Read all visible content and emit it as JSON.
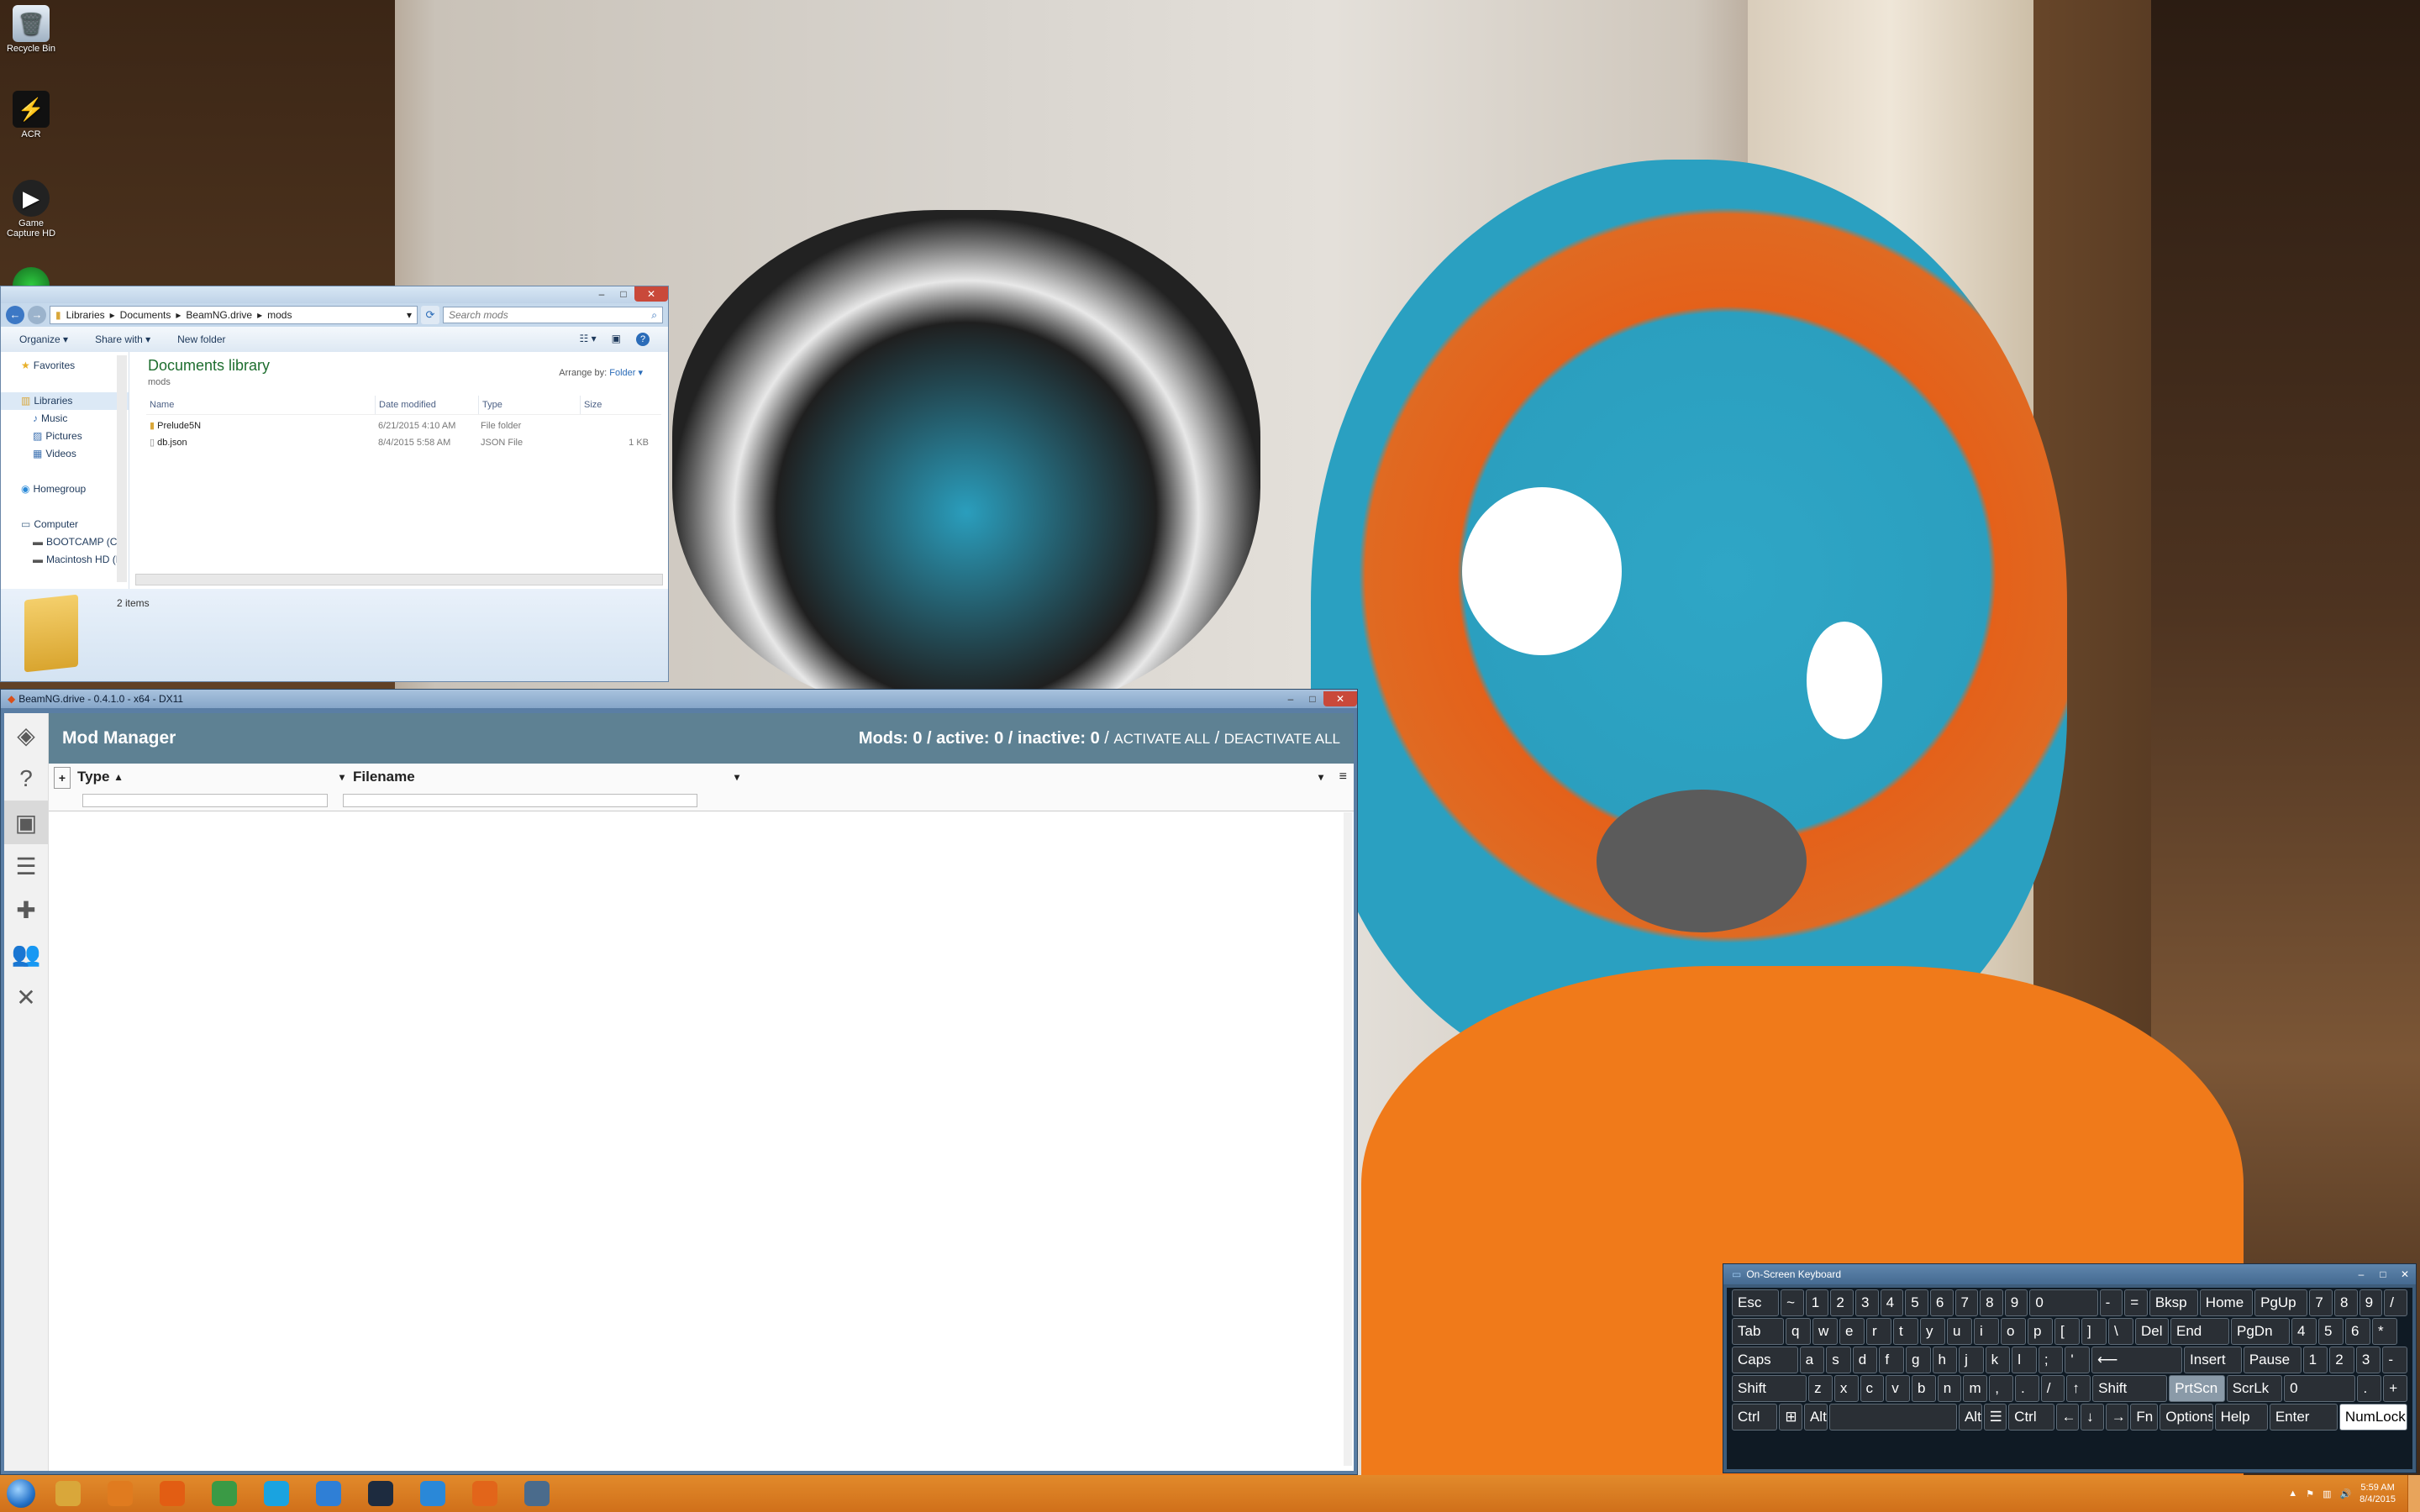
{
  "desktop": {
    "icons": [
      {
        "label": "Recycle Bin",
        "icon": "recycle-bin-icon"
      },
      {
        "label": "ACR",
        "icon": "acr-icon"
      },
      {
        "label": "Game Capture HD",
        "icon": "game-capture-icon"
      }
    ]
  },
  "explorer": {
    "breadcrumb": [
      "Libraries",
      "Documents",
      "BeamNG.drive",
      "mods"
    ],
    "search_placeholder": "Search mods",
    "commands": {
      "organize": "Organize ▾",
      "share": "Share with ▾",
      "new_folder": "New folder"
    },
    "nav": {
      "favorites": "Favorites",
      "libraries": "Libraries",
      "music": "Music",
      "pictures": "Pictures",
      "videos": "Videos",
      "homegroup": "Homegroup",
      "computer": "Computer",
      "bootcamp": "BOOTCAMP (C:)",
      "mac": "Macintosh HD (D:"
    },
    "library_title": "Documents library",
    "library_sub": "mods",
    "arrange_by": "Arrange by:",
    "arrange_value": "Folder ▾",
    "columns": {
      "name": "Name",
      "date": "Date modified",
      "type": "Type",
      "size": "Size"
    },
    "files": [
      {
        "name": "Prelude5N",
        "date": "6/21/2015 4:10 AM",
        "type": "File folder",
        "size": ""
      },
      {
        "name": "db.json",
        "date": "8/4/2015 5:58 AM",
        "type": "JSON File",
        "size": "1 KB"
      }
    ],
    "item_count": "2 items"
  },
  "beamng": {
    "window_title": "BeamNG.drive - 0.4.1.0 - x64 - DX11",
    "page_title": "Mod Manager",
    "stats": {
      "mods": "Mods: 0",
      "active": "active: 0",
      "inactive": "inactive: 0",
      "activate_all": "ACTIVATE ALL",
      "deactivate_all": "DEACTIVATE ALL",
      "sep": "/"
    },
    "columns": {
      "type": "Type",
      "filename": "Filename"
    }
  },
  "keyboard": {
    "title": "On-Screen Keyboard",
    "rows": [
      [
        "Esc",
        "~",
        "1",
        "2",
        "3",
        "4",
        "5",
        "6",
        "7",
        "8",
        "9",
        "0",
        "-",
        "=",
        "Bksp",
        "Home",
        "PgUp",
        "7",
        "8",
        "9",
        "/"
      ],
      [
        "Tab",
        "q",
        "w",
        "e",
        "r",
        "t",
        "y",
        "u",
        "i",
        "o",
        "p",
        "[",
        "]",
        "\\",
        "Del",
        "End",
        "PgDn",
        "4",
        "5",
        "6",
        "*"
      ],
      [
        "Caps",
        "a",
        "s",
        "d",
        "f",
        "g",
        "h",
        "j",
        "k",
        "l",
        ";",
        "'",
        "⟵",
        "Insert",
        "Pause",
        "1",
        "2",
        "3",
        "-"
      ],
      [
        "Shift",
        "z",
        "x",
        "c",
        "v",
        "b",
        "n",
        "m",
        ",",
        ".",
        "/",
        "↑",
        "Shift",
        "PrtScn",
        "ScrLk",
        "0",
        ".",
        "+"
      ],
      [
        "Ctrl",
        "⊞",
        "Alt",
        "",
        "Alt",
        "☰",
        "Ctrl",
        "←",
        "↓",
        "→",
        "Fn",
        "Options",
        "Help",
        "Enter",
        "NumLock"
      ]
    ]
  },
  "taskbar": {
    "apps": [
      {
        "icon": "explorer-icon",
        "color": "#d9a73a"
      },
      {
        "icon": "media-player-icon",
        "color": "#e07b1f"
      },
      {
        "icon": "firefox-icon",
        "color": "#e25d13"
      },
      {
        "icon": "chrome-icon",
        "color": "#3a9a45"
      },
      {
        "icon": "skype-icon",
        "color": "#1aa3e0"
      },
      {
        "icon": "dropbox-icon",
        "color": "#2f7fd6"
      },
      {
        "icon": "steam-icon",
        "color": "#1d2b3f"
      },
      {
        "icon": "ie-icon",
        "color": "#2a88d8"
      },
      {
        "icon": "beamng-icon",
        "color": "#e2651a"
      },
      {
        "icon": "keyboard-icon",
        "color": "#4a6b8c"
      }
    ],
    "time": "5:59 AM",
    "date": "8/4/2015"
  }
}
